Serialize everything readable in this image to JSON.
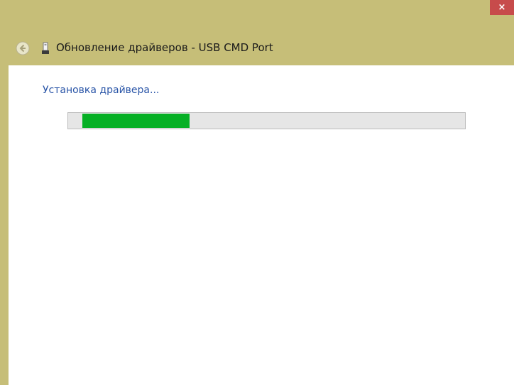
{
  "window": {
    "close_label": "×",
    "title": "Обновление драйверов - USB CMD Port",
    "frame_color": "#c6be78",
    "close_color": "#c74b4b"
  },
  "content": {
    "status_text": "Установка драйвера...",
    "progress_fraction": 0.27,
    "progress_color": "#06b025"
  },
  "icons": {
    "back": "back-arrow-icon",
    "device": "usb-device-icon",
    "close": "close-icon"
  }
}
